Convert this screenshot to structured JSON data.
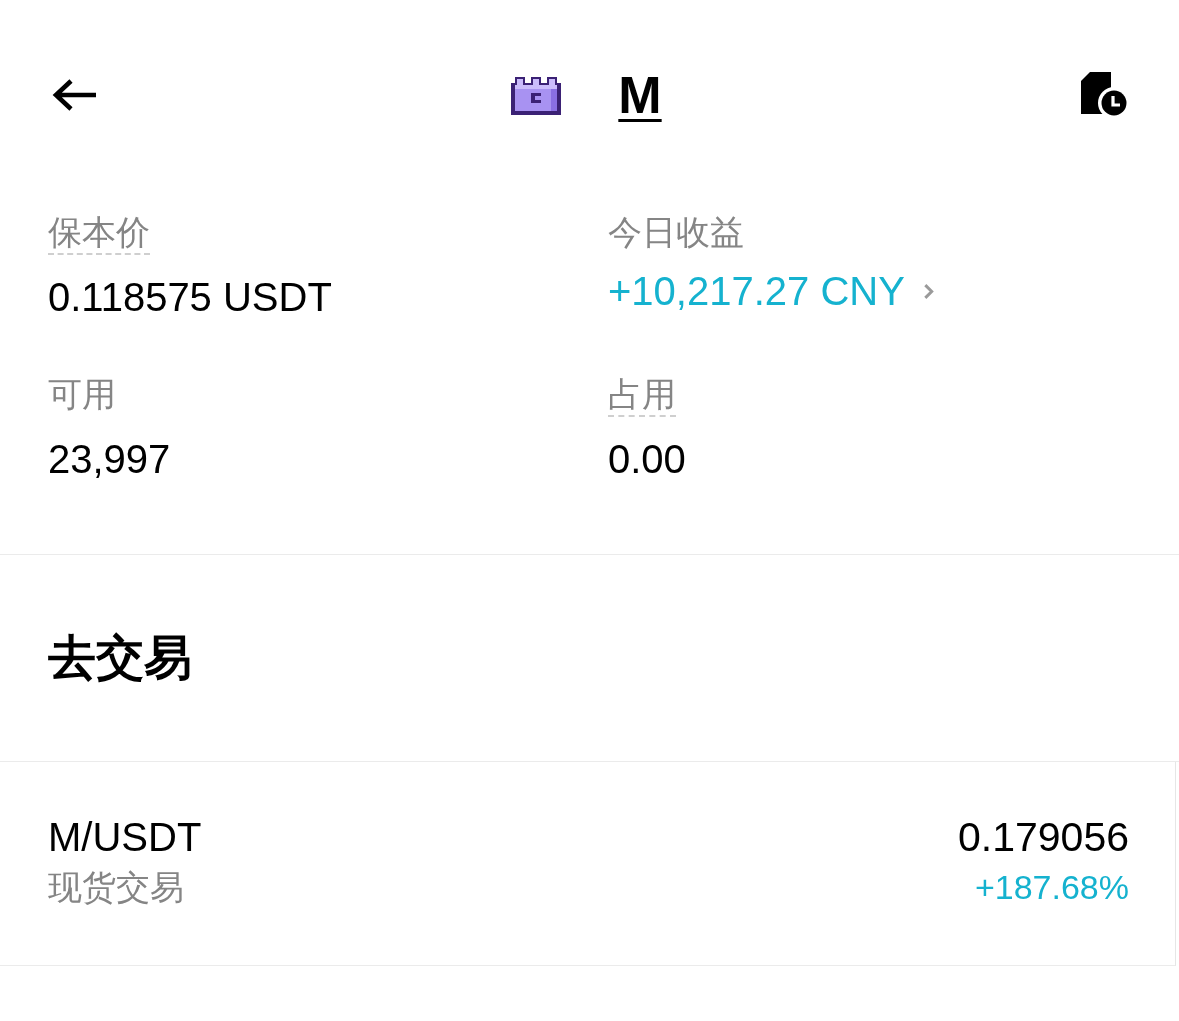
{
  "header": {
    "title": "M"
  },
  "stats": [
    {
      "label": "保本价",
      "value": "0.118575 USDT",
      "kind": "plain",
      "underlined": true
    },
    {
      "label": "今日收益",
      "value": "+10,217.27 CNY",
      "kind": "link",
      "underlined": false
    },
    {
      "label": "可用",
      "value": "23,997",
      "kind": "plain",
      "underlined": false
    },
    {
      "label": "占用",
      "value": "0.00",
      "kind": "plain",
      "underlined": true
    }
  ],
  "trade": {
    "heading": "去交易",
    "markets": [
      {
        "pair": "M/USDT",
        "type": "现货交易",
        "price": "0.179056",
        "change": "+187.68%",
        "positive": true
      }
    ]
  }
}
